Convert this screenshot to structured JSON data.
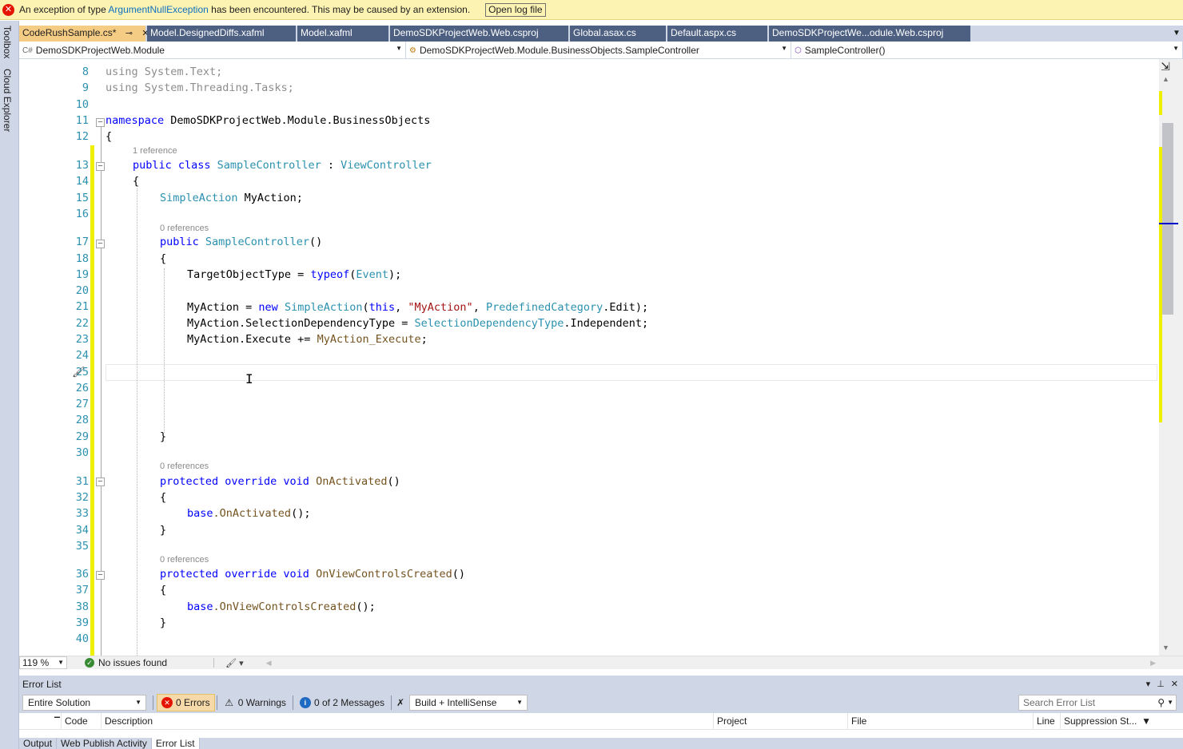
{
  "infobar": {
    "prefix": "An exception of type",
    "exception": "ArgumentNullException",
    "suffix": "has been encountered. This may be caused by an extension.",
    "button": "Open log file"
  },
  "side_strip": {
    "toolbox": "Toolbox",
    "cloud": "Cloud Explorer"
  },
  "tabs": [
    {
      "label": "CodeRushSample.cs*",
      "active": true
    },
    {
      "label": "Model.DesignedDiffs.xafml"
    },
    {
      "label": "Model.xafml"
    },
    {
      "label": "DemoSDKProjectWeb.Web.csproj"
    },
    {
      "label": "Global.asax.cs"
    },
    {
      "label": "Default.aspx.cs"
    },
    {
      "label": "DemoSDKProjectWe...odule.Web.csproj"
    }
  ],
  "navbar": {
    "project": "DemoSDKProjectWeb.Module",
    "type": "DemoSDKProjectWeb.Module.BusinessObjects.SampleController",
    "member": "SampleController()"
  },
  "code": {
    "line_numbers": [
      "8",
      "9",
      "10",
      "11",
      "12",
      "13",
      "14",
      "15",
      "16",
      "17",
      "18",
      "19",
      "20",
      "21",
      "22",
      "23",
      "24",
      "25",
      "26",
      "27",
      "28",
      "29",
      "30",
      "31",
      "32",
      "33",
      "34",
      "35",
      "36",
      "37",
      "38",
      "39",
      "40"
    ],
    "lines": {
      "l8_kw": "using",
      "l8_rest": " System.Text;",
      "l9_kw": "using",
      "l9_rest": " System.Threading.Tasks;",
      "l11_kw": "namespace",
      "l11_rest": " DemoSDKProjectWeb.Module.BusinessObjects",
      "l12": "{",
      "lens_13": "1 reference",
      "l13_kw": "public class",
      "l13_name": " SampleController",
      "l13_colon": " : ",
      "l13_base": "ViewController",
      "l14": "{",
      "l15_type": "SimpleAction",
      "l15_rest": " MyAction;",
      "lens_17": "0 references",
      "l17_kw": "public",
      "l17_name": " SampleController",
      "l17_rest": "()",
      "l18": "{",
      "l19_a": "TargetObjectType = ",
      "l19_kw": "typeof",
      "l19_b": "(",
      "l19_ty": "Event",
      "l19_c": ");",
      "l21_a": "MyAction = ",
      "l21_kw": "new",
      "l21_sp": " ",
      "l21_ty": "SimpleAction",
      "l21_b": "(",
      "l21_this": "this",
      "l21_c": ", ",
      "l21_str": "\"MyAction\"",
      "l21_d": ", ",
      "l21_ty2": "PredefinedCategory",
      "l21_e": ".Edit);",
      "l22_a": "MyAction.SelectionDependencyType = ",
      "l22_ty": "SelectionDependencyType",
      "l22_b": ".Independent;",
      "l23_a": "MyAction.Execute += ",
      "l23_m": "MyAction_Execute",
      "l23_b": ";",
      "l29": "}",
      "lens_31": "0 references",
      "l31_kw": "protected override void",
      "l31_m": " OnActivated",
      "l31_b": "()",
      "l32": "{",
      "l33_kw": "base",
      "l33_m": ".OnActivated",
      "l33_b": "();",
      "l34": "}",
      "lens_36": "0 references",
      "l36_kw": "protected override void",
      "l36_m": " OnViewControlsCreated",
      "l36_b": "()",
      "l37": "{",
      "l38_kw": "base",
      "l38_m": ".OnViewControlsCreated",
      "l38_b": "();",
      "l39": "}"
    }
  },
  "status": {
    "zoom": "119 %",
    "issues": "No issues found"
  },
  "error_list": {
    "title": "Error List",
    "scope": "Entire Solution",
    "errors": "0 Errors",
    "warnings": "0 Warnings",
    "messages": "0 of 2 Messages",
    "build_filter": "Build + IntelliSense",
    "search_placeholder": "Search Error List",
    "columns": [
      "Code",
      "Description",
      "Project",
      "File",
      "Line",
      "Suppression St..."
    ]
  },
  "bottom_tabs": [
    {
      "label": "Output"
    },
    {
      "label": "Web Publish Activity"
    },
    {
      "label": "Error List",
      "active": true
    }
  ],
  "colors": {
    "accent_tab": "#f5cc84",
    "chrome": "#cfd6e5",
    "change_bar": "#efef00",
    "keyword": "#0000ff",
    "type": "#2b91af",
    "string": "#a31515"
  }
}
